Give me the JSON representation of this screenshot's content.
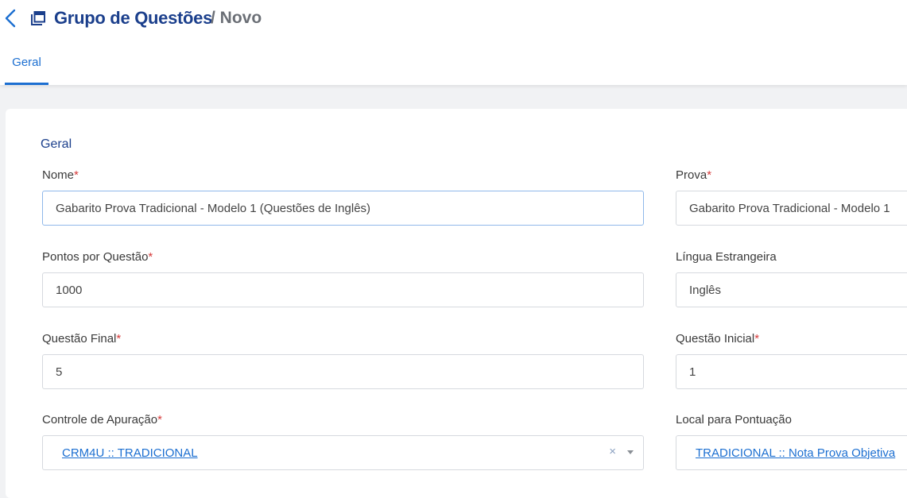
{
  "header": {
    "title": "Grupo de Questões",
    "subtitle": "/ Novo",
    "back_icon": "chevron-left-icon",
    "page_icon": "copy-window-icon"
  },
  "tabs": [
    {
      "label": "Geral",
      "active": true
    }
  ],
  "section": {
    "title": "Geral"
  },
  "fields": {
    "nome": {
      "label": "Nome",
      "required_mark": "*",
      "value": "Gabarito Prova Tradicional - Modelo 1 (Questões de Inglês)"
    },
    "prova": {
      "label": "Prova",
      "required_mark": "*",
      "value": "Gabarito Prova Tradicional - Modelo 1"
    },
    "pontos": {
      "label": "Pontos por Questão",
      "required_mark": "*",
      "value": "1000"
    },
    "lingua": {
      "label": "Língua Estrangeira",
      "value": "Inglês"
    },
    "questao_final": {
      "label": "Questão Final",
      "required_mark": "*",
      "value": "5"
    },
    "questao_inicial": {
      "label": "Questão Inicial",
      "required_mark": "*",
      "value": "1"
    },
    "controle": {
      "label": "Controle de Apuração",
      "required_mark": "*",
      "value": "CRM4U :: TRADICIONAL",
      "clear_symbol": "×"
    },
    "local": {
      "label": "Local para Pontuação",
      "value": "TRADICIONAL :: Nota Prova Objetiva"
    }
  },
  "colors": {
    "accent": "#1c6fd1",
    "title": "#1b3f8c",
    "required": "#d63a3a",
    "background": "#f1f2f4"
  }
}
